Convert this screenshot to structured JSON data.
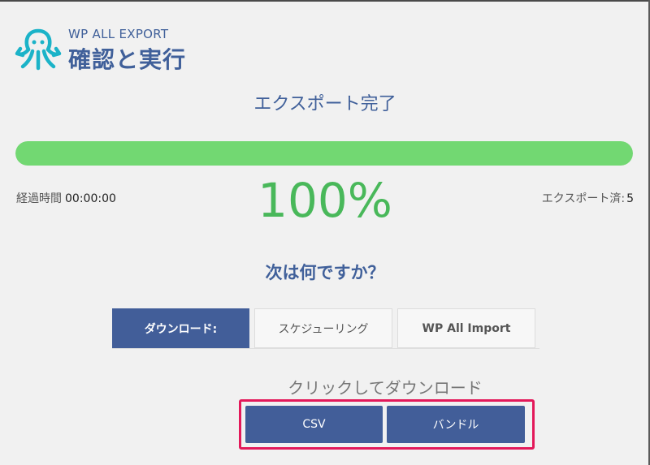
{
  "header": {
    "brand": "WP ALL EXPORT",
    "title": "確認と実行",
    "logo_icon": "octopus-icon",
    "brand_color": "#40609a",
    "logo_color": "#1bb3c8"
  },
  "status": {
    "heading": "エクスポート完了",
    "progress_fraction": 1.0,
    "progress_color": "#72d872",
    "percent_text": "100%",
    "elapsed_label": "経過時間",
    "elapsed_value": "00:00:00",
    "exported_label": "エクスポート済:",
    "exported_value": "5"
  },
  "next": {
    "heading": "次は何ですか？",
    "tabs": [
      {
        "label": "ダウンロード:",
        "active": true
      },
      {
        "label": "スケジューリング",
        "active": false
      },
      {
        "label": "WP All Import",
        "active": false
      }
    ],
    "download_caption": "クリックしてダウンロード",
    "buttons": {
      "csv": "CSV",
      "bundle": "バンドル"
    },
    "highlight_color": "#e3195a"
  }
}
